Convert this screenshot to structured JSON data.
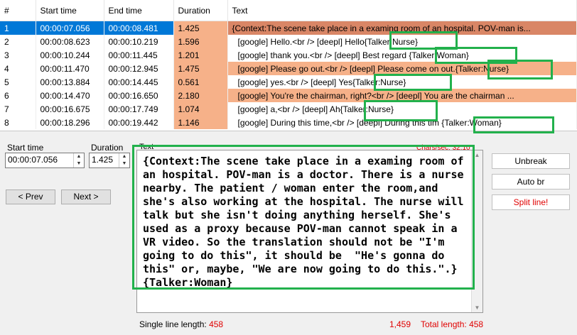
{
  "grid": {
    "headers": [
      "#",
      "Start time",
      "End time",
      "Duration",
      "Text"
    ],
    "rows": [
      {
        "num": "1",
        "start": "00:00:07.056",
        "end": "00:00:08.481",
        "dur": "1.425",
        "text": "{Context:The scene take place in a examing room of an hospital. POV-man is..."
      },
      {
        "num": "2",
        "start": "00:00:08.623",
        "end": "00:00:10.219",
        "dur": "1.596",
        "text": "[google] Hello.<br />   [deepl] Hello{Talker:Nurse}"
      },
      {
        "num": "3",
        "start": "00:00:10.244",
        "end": "00:00:11.445",
        "dur": "1.201",
        "text": "[google] thank you.<br />   [deepl] Best regard  {Talker:Woman}"
      },
      {
        "num": "4",
        "start": "00:00:11.470",
        "end": "00:00:12.945",
        "dur": "1.475",
        "text": "[google] Please go out.<br />   [deepl] Please come on out.{Talker:Nurse}"
      },
      {
        "num": "5",
        "start": "00:00:13.884",
        "end": "00:00:14.445",
        "dur": "0.561",
        "text": "[google] yes.<br />   [deepl] Yes{Talker:Nurse}"
      },
      {
        "num": "6",
        "start": "00:00:14.470",
        "end": "00:00:16.650",
        "dur": "2.180",
        "text": "[google] You're the chairman, right?<br />   [deepl] You are the chairman ..."
      },
      {
        "num": "7",
        "start": "00:00:16.675",
        "end": "00:00:17.749",
        "dur": "1.074",
        "text": "[google] a,<br />   [deepl] Ah{Talker:Nurse}"
      },
      {
        "num": "8",
        "start": "00:00:18.296",
        "end": "00:00:19.442",
        "dur": "1.146",
        "text": "[google] During this time,<br />   [deepl] During this tim {Talker:Woman}"
      }
    ]
  },
  "editor": {
    "start_label": "Start time",
    "start_value": "00:00:07.056",
    "duration_label": "Duration",
    "duration_value": "1.425",
    "text_label": "Text",
    "chars_sec": "Chars/sec: 32.10",
    "prev_label": "< Prev",
    "next_label": "Next >",
    "unbreak_label": "Unbreak",
    "autobr_label": "Auto br",
    "split_label": "Split line!",
    "text": "{Context:The scene take place in a examing room of an hospital. POV-man is a doctor. There is a nurse nearby. The patient / woman enter the room,and she's also working at the hospital. The nurse will talk but she isn't doing anything herself. She's used as a proxy because POV-man cannot speak in a VR video. So the translation should not be \"I'm going to do this\", it should be  \"He's gonna do this\" or, maybe, \"We are now going to do this.\".}{Talker:Woman}",
    "single_line_label": "Single line length:",
    "single_line_value": "458",
    "pos_value": "1,459",
    "total_label": "Total length:",
    "total_value": "458"
  },
  "colors": {
    "highlight": "#f6b189",
    "selected": "#0078d7",
    "annotation": "#22b14c"
  }
}
